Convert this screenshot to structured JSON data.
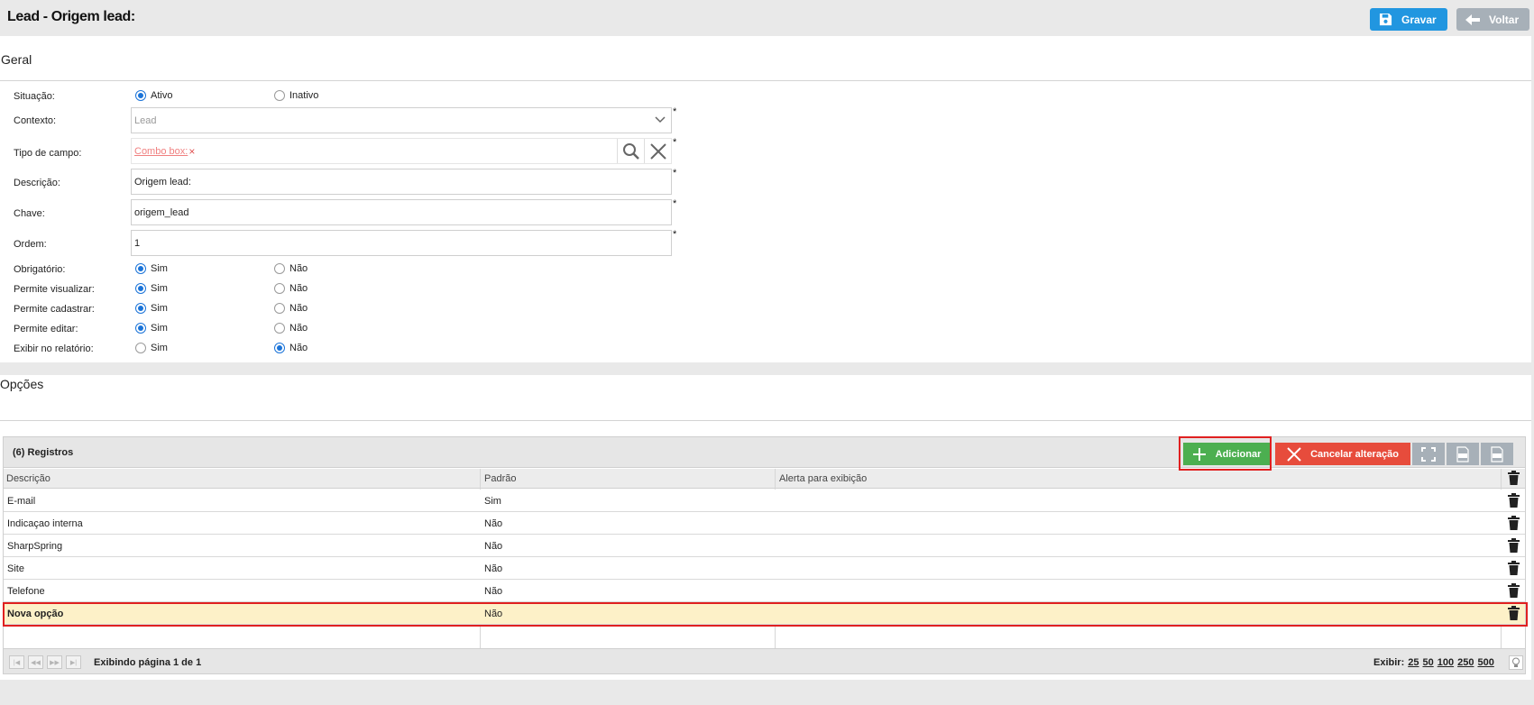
{
  "header": {
    "title": "Lead - Origem lead:",
    "save_label": "Gravar",
    "back_label": "Voltar"
  },
  "geral": {
    "title": "Geral",
    "situacao": {
      "label": "Situação:",
      "options": [
        "Ativo",
        "Inativo"
      ],
      "selected": "Ativo"
    },
    "contexto": {
      "label": "Contexto:",
      "value": "Lead"
    },
    "tipo_campo": {
      "label": "Tipo de campo:",
      "value": "Combo box:",
      "clear": "×"
    },
    "descricao": {
      "label": "Descrição:",
      "value": "Origem lead:"
    },
    "chave": {
      "label": "Chave:",
      "value": "origem_lead"
    },
    "ordem": {
      "label": "Ordem:",
      "value": "1"
    },
    "required_mark": "*",
    "radios": [
      {
        "label": "Obrigatório:",
        "yes": "Sim",
        "no": "Não",
        "selected": "Sim"
      },
      {
        "label": "Permite visualizar:",
        "yes": "Sim",
        "no": "Não",
        "selected": "Sim"
      },
      {
        "label": "Permite cadastrar:",
        "yes": "Sim",
        "no": "Não",
        "selected": "Sim"
      },
      {
        "label": "Permite editar:",
        "yes": "Sim",
        "no": "Não",
        "selected": "Sim"
      },
      {
        "label": "Exibir no relatório:",
        "yes": "Sim",
        "no": "Não",
        "selected": "Não"
      }
    ]
  },
  "opcoes": {
    "title": "Opções",
    "grid": {
      "count_label": "(6) Registros",
      "add_label": "Adicionar",
      "cancel_label": "Cancelar alteração",
      "columns": [
        "Descrição",
        "Padrão",
        "Alerta para exibição"
      ],
      "rows": [
        {
          "descricao": "E-mail",
          "padrao": "Sim",
          "alerta": ""
        },
        {
          "descricao": "Indicaçao interna",
          "padrao": "Não",
          "alerta": ""
        },
        {
          "descricao": "SharpSpring",
          "padrao": "Não",
          "alerta": ""
        },
        {
          "descricao": "Site",
          "padrao": "Não",
          "alerta": ""
        },
        {
          "descricao": "Telefone",
          "padrao": "Não",
          "alerta": ""
        },
        {
          "descricao": "Nova opção",
          "padrao": "Não",
          "alerta": ""
        }
      ],
      "pager": {
        "info": "Exibindo página 1 de 1",
        "show_label": "Exibir:",
        "page_sizes": [
          "25",
          "50",
          "100",
          "250",
          "500"
        ]
      }
    }
  },
  "colors": {
    "primary": "#2196e0",
    "secondary": "#a7b0b8",
    "success": "#4caf50",
    "danger": "#e74c3c",
    "highlight": "#e02020",
    "selected_row": "#fdf1c8"
  }
}
